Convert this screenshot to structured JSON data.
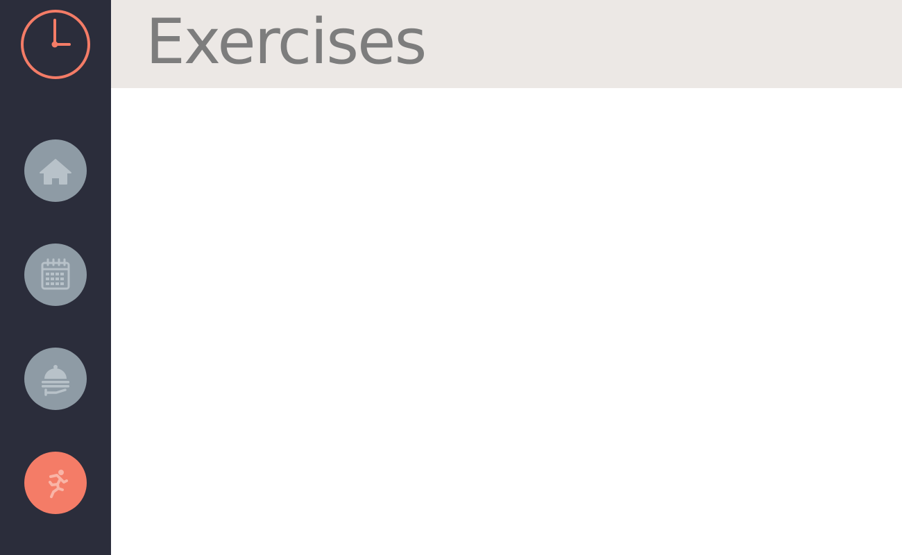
{
  "app": {
    "logo_icon": "clock-icon",
    "accent_color": "#f47c67",
    "sidebar_color": "#2b2d3b",
    "inactive_button_color": "#8e9ba5",
    "inactive_icon_color": "#b8c2c9",
    "active_icon_color": "#f9b5a7",
    "header_color": "#ece8e5",
    "title_color": "#7d7d7d"
  },
  "sidebar": {
    "items": [
      {
        "icon": "home-icon",
        "active": false
      },
      {
        "icon": "calendar-icon",
        "active": false
      },
      {
        "icon": "meal-cloche-icon",
        "active": false
      },
      {
        "icon": "running-person-icon",
        "active": true
      }
    ]
  },
  "header": {
    "title": "Exercises"
  }
}
